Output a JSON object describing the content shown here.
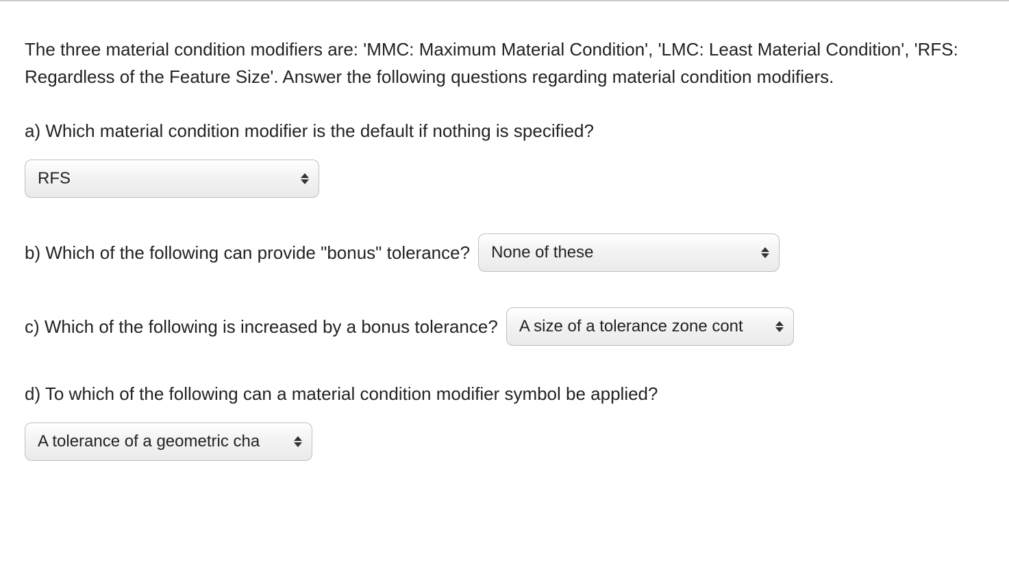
{
  "intro": "The three material condition modifiers are: 'MMC: Maximum Material Condition', 'LMC: Least Material Condition', 'RFS: Regardless of the Feature Size'. Answer the following questions regarding material condition modifiers.",
  "questions": {
    "a": {
      "text": "a) Which material condition modifier is the default if nothing is specified?",
      "selected": "RFS"
    },
    "b": {
      "text": "b) Which of the following can provide \"bonus\" tolerance?",
      "selected": "None of these"
    },
    "c": {
      "text": "c) Which of the following is increased by a bonus tolerance?",
      "selected": "A size of a tolerance zone cont"
    },
    "d": {
      "text": "d) To which of the following can a material condition modifier symbol be applied?",
      "selected": "A tolerance of a geometric cha"
    }
  }
}
